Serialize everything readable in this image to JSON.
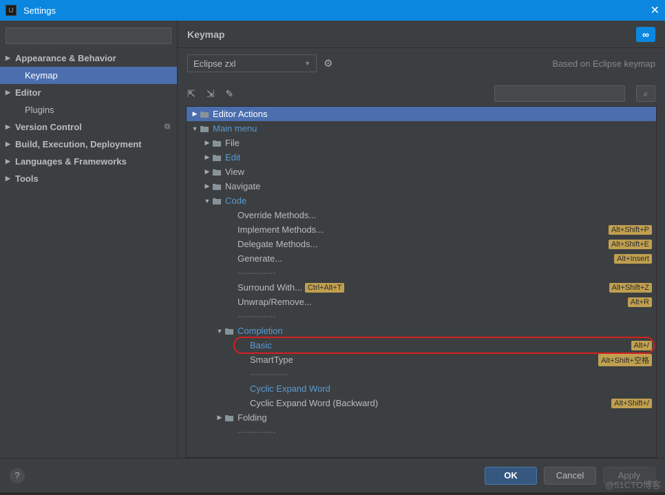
{
  "window": {
    "title": "Settings"
  },
  "sidebar": {
    "search_placeholder": "",
    "items": [
      {
        "label": "Appearance & Behavior",
        "arrow": true,
        "bold": true
      },
      {
        "label": "Keymap",
        "arrow": false,
        "selected": true,
        "sub": true
      },
      {
        "label": "Editor",
        "arrow": true,
        "bold": true
      },
      {
        "label": "Plugins",
        "arrow": false,
        "sub": true
      },
      {
        "label": "Version Control",
        "arrow": true,
        "bold": true,
        "copy": true
      },
      {
        "label": "Build, Execution, Deployment",
        "arrow": true,
        "bold": true
      },
      {
        "label": "Languages & Frameworks",
        "arrow": true,
        "bold": true
      },
      {
        "label": "Tools",
        "arrow": true,
        "bold": true
      }
    ]
  },
  "content": {
    "title": "Keymap",
    "dropdown_value": "Eclipse zxl",
    "based_on": "Based on Eclipse keymap",
    "search_placeholder": ""
  },
  "tree": [
    {
      "depth": 0,
      "label": "Editor Actions",
      "arrow": "▶",
      "icon": "folder-sel",
      "selected": true
    },
    {
      "depth": 0,
      "label": "Main menu",
      "arrow": "▼",
      "icon": "folder",
      "link": true
    },
    {
      "depth": 1,
      "label": "File",
      "arrow": "▶",
      "icon": "folder"
    },
    {
      "depth": 1,
      "label": "Edit",
      "arrow": "▶",
      "icon": "folder",
      "link": true
    },
    {
      "depth": 1,
      "label": "View",
      "arrow": "▶",
      "icon": "folder"
    },
    {
      "depth": 1,
      "label": "Navigate",
      "arrow": "▶",
      "icon": "folder"
    },
    {
      "depth": 1,
      "label": "Code",
      "arrow": "▼",
      "icon": "folder",
      "link": true
    },
    {
      "depth": 2,
      "label": "Override Methods...",
      "icon": ""
    },
    {
      "depth": 2,
      "label": "Implement Methods...",
      "icon": "",
      "shortcuts": [
        "Alt+Shift+P"
      ]
    },
    {
      "depth": 2,
      "label": "Delegate Methods...",
      "icon": "",
      "shortcuts": [
        "Alt+Shift+E"
      ]
    },
    {
      "depth": 2,
      "label": "Generate...",
      "icon": "",
      "shortcuts": [
        "Alt+Insert"
      ]
    },
    {
      "depth": 2,
      "label": "------------",
      "icon": "",
      "sep": true
    },
    {
      "depth": 2,
      "label": "Surround With...",
      "icon": "",
      "shortcuts": [
        "Alt+Shift+Z",
        "Ctrl+Alt+T"
      ]
    },
    {
      "depth": 2,
      "label": "Unwrap/Remove...",
      "icon": "",
      "shortcuts": [
        "Alt+R"
      ]
    },
    {
      "depth": 2,
      "label": "------------",
      "icon": "",
      "sep": true
    },
    {
      "depth": 2,
      "label": "Completion",
      "arrow": "▼",
      "icon": "folder",
      "link": true
    },
    {
      "depth": 3,
      "label": "Basic",
      "icon": "",
      "link": true,
      "shortcuts": [
        "Alt+/"
      ],
      "highlight": true
    },
    {
      "depth": 3,
      "label": "SmartType",
      "icon": "",
      "shortcuts": [
        "Alt+Shift+空格"
      ]
    },
    {
      "depth": 3,
      "label": "------------",
      "icon": "",
      "sep": true
    },
    {
      "depth": 3,
      "label": "Cyclic Expand Word",
      "icon": "",
      "link": true
    },
    {
      "depth": 3,
      "label": "Cyclic Expand Word (Backward)",
      "icon": "",
      "shortcuts": [
        "Alt+Shift+/"
      ]
    },
    {
      "depth": 2,
      "label": "Folding",
      "arrow": "▶",
      "icon": "folder"
    },
    {
      "depth": 2,
      "label": "------------",
      "icon": "",
      "sep": true
    }
  ],
  "footer": {
    "ok": "OK",
    "cancel": "Cancel",
    "apply": "Apply"
  },
  "watermark": "@51CTO博客"
}
